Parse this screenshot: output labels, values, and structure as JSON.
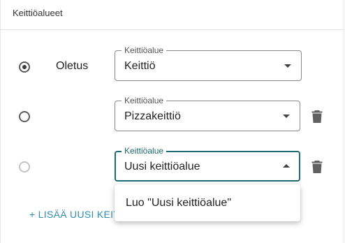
{
  "header": {
    "title": "Keittiöalueet"
  },
  "rows": [
    {
      "default_label": "Oletus",
      "field_label": "Keittiöalue",
      "value": "Keittiö"
    },
    {
      "field_label": "Keittiöalue",
      "value": "Pizzakeittiö"
    },
    {
      "field_label": "Keittiöalue",
      "value": "Uusi keittiöalue"
    }
  ],
  "add_button": {
    "label": "+ LISÄÄ UUSI KEITTIÖALUE"
  },
  "dropdown": {
    "option": "Luo \"Uusi keittiöalue\""
  },
  "colors": {
    "accent": "#1e6b73",
    "link": "#2f8fb0"
  },
  "icons": {
    "delete": "trash-icon",
    "expand": "caret-down-icon",
    "collapse": "caret-up-icon"
  }
}
